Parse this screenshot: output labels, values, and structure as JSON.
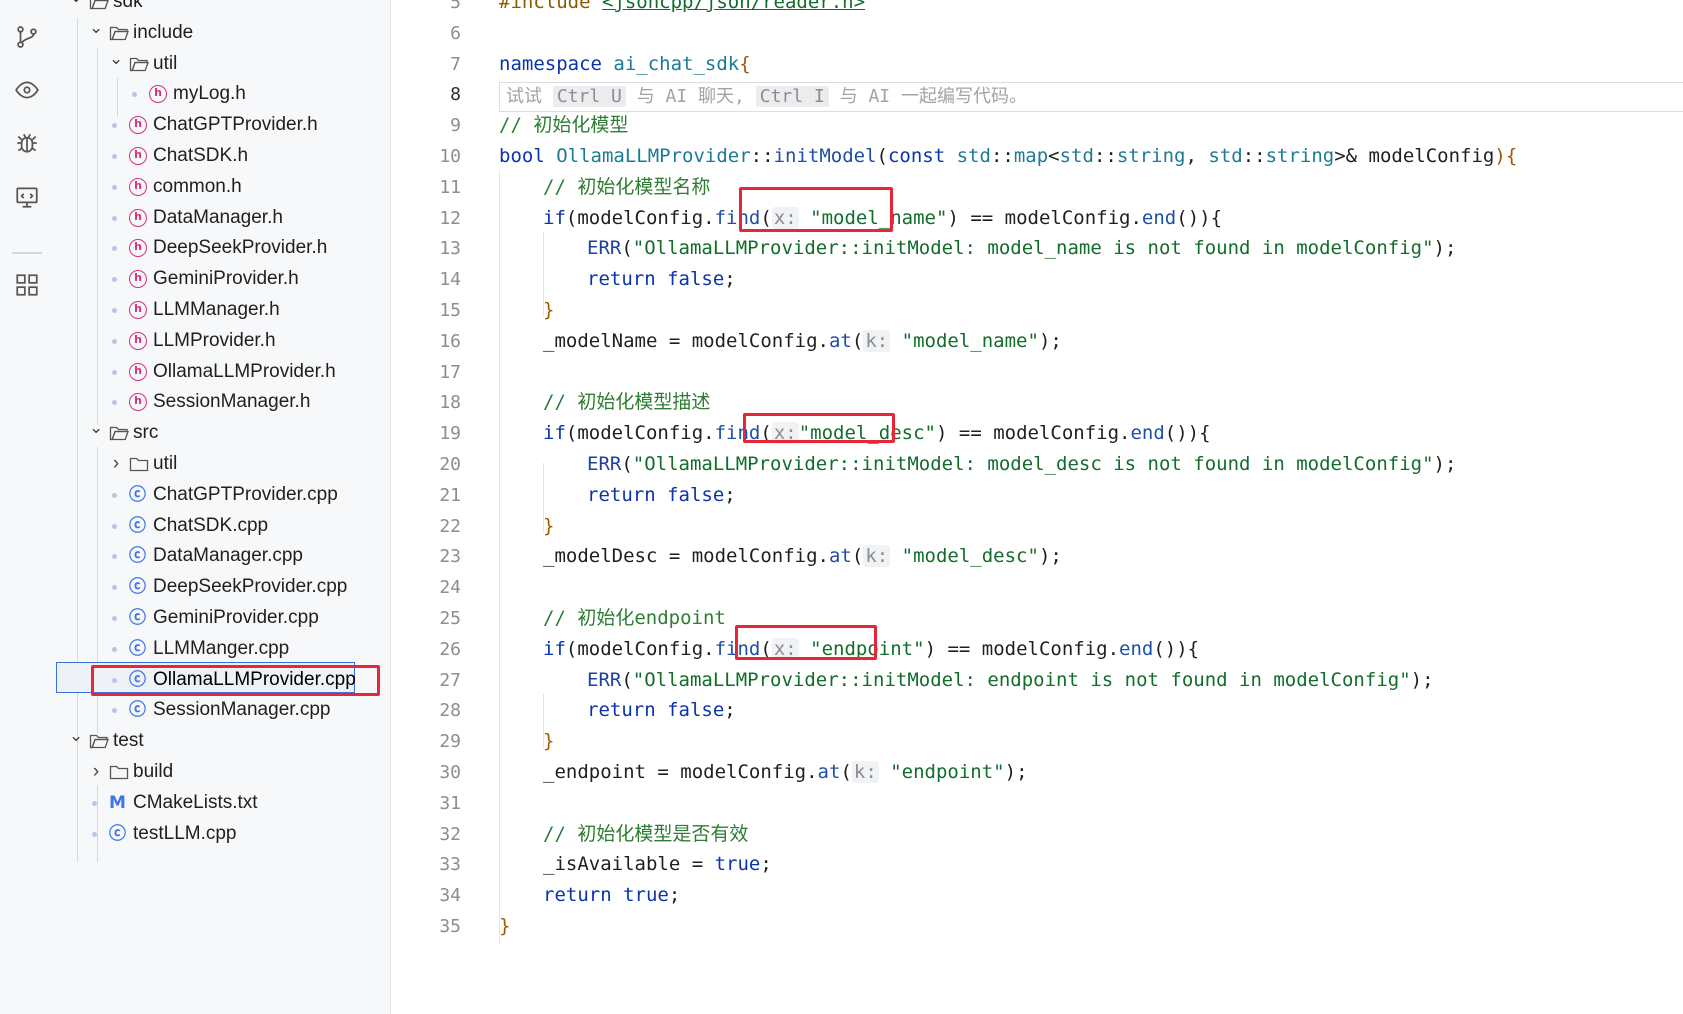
{
  "explorer": {
    "items": [
      {
        "label": "sdk",
        "kind": "folder",
        "expanded": true,
        "depth": 0
      },
      {
        "label": "include",
        "kind": "folder",
        "expanded": true,
        "depth": 1
      },
      {
        "label": "util",
        "kind": "folder",
        "expanded": true,
        "depth": 2
      },
      {
        "label": "myLog.h",
        "kind": "header",
        "depth": 3
      },
      {
        "label": "ChatGPTProvider.h",
        "kind": "header",
        "depth": 2
      },
      {
        "label": "ChatSDK.h",
        "kind": "header",
        "depth": 2
      },
      {
        "label": "common.h",
        "kind": "header",
        "depth": 2
      },
      {
        "label": "DataManager.h",
        "kind": "header",
        "depth": 2
      },
      {
        "label": "DeepSeekProvider.h",
        "kind": "header",
        "depth": 2
      },
      {
        "label": "GeminiProvider.h",
        "kind": "header",
        "depth": 2
      },
      {
        "label": "LLMManager.h",
        "kind": "header",
        "depth": 2
      },
      {
        "label": "LLMProvider.h",
        "kind": "header",
        "depth": 2
      },
      {
        "label": "OllamaLLMProvider.h",
        "kind": "header",
        "depth": 2
      },
      {
        "label": "SessionManager.h",
        "kind": "header",
        "depth": 2
      },
      {
        "label": "src",
        "kind": "folder",
        "expanded": true,
        "depth": 1
      },
      {
        "label": "util",
        "kind": "folder",
        "expanded": false,
        "depth": 2
      },
      {
        "label": "ChatGPTProvider.cpp",
        "kind": "cpp",
        "depth": 2
      },
      {
        "label": "ChatSDK.cpp",
        "kind": "cpp",
        "depth": 2
      },
      {
        "label": "DataManager.cpp",
        "kind": "cpp",
        "depth": 2
      },
      {
        "label": "DeepSeekProvider.cpp",
        "kind": "cpp",
        "depth": 2
      },
      {
        "label": "GeminiProvider.cpp",
        "kind": "cpp",
        "depth": 2
      },
      {
        "label": "LLMManger.cpp",
        "kind": "cpp",
        "depth": 2
      },
      {
        "label": "OllamaLLMProvider.cpp",
        "kind": "cpp",
        "depth": 2,
        "selected": true
      },
      {
        "label": "SessionManager.cpp",
        "kind": "cpp",
        "depth": 2
      },
      {
        "label": "test",
        "kind": "folder",
        "expanded": true,
        "depth": 0
      },
      {
        "label": "build",
        "kind": "folder",
        "expanded": false,
        "depth": 1
      },
      {
        "label": "CMakeLists.txt",
        "kind": "cmake",
        "depth": 1
      },
      {
        "label": "testLLM.cpp",
        "kind": "cpp",
        "depth": 1
      }
    ]
  },
  "editor": {
    "current_line": "8",
    "ai_hint": {
      "pre": "试试 ",
      "key1": "Ctrl U",
      "mid": " 与 AI 聊天, ",
      "key2": "Ctrl I",
      "post": " 与 AI 一起编写代码。"
    },
    "lines": [
      {
        "n": "5",
        "tokens": [
          [
            "inc",
            "#include "
          ],
          [
            "incp",
            "<jsoncpp/json/reader.h>"
          ]
        ]
      },
      {
        "n": "6",
        "tokens": []
      },
      {
        "n": "7",
        "tokens": [
          [
            "kw",
            "namespace "
          ],
          [
            "ns",
            "ai_chat_sdk"
          ],
          [
            "br",
            "{"
          ]
        ]
      },
      {
        "n": "8",
        "tokens": []
      },
      {
        "n": "9",
        "tokens": [
          [
            "cm",
            "// 初始化模型"
          ]
        ]
      },
      {
        "n": "10",
        "tokens": [
          [
            "kw",
            "bool "
          ],
          [
            "ty",
            "OllamaLLMProvider"
          ],
          [
            "pm",
            "::"
          ],
          [
            "fn",
            "initModel"
          ],
          [
            "pm",
            "("
          ],
          [
            "kw",
            "const "
          ],
          [
            "ty",
            "std"
          ],
          [
            "pm",
            "::"
          ],
          [
            "ty",
            "map"
          ],
          [
            "pm",
            "<"
          ],
          [
            "ty",
            "std"
          ],
          [
            "pm",
            "::"
          ],
          [
            "ty",
            "string"
          ],
          [
            "pm",
            ", "
          ],
          [
            "ty",
            "std"
          ],
          [
            "pm",
            "::"
          ],
          [
            "ty",
            "string"
          ],
          [
            "pm",
            ">& "
          ],
          [
            "pm",
            "modelConfig"
          ],
          [
            "br",
            ")"
          ],
          [
            "br",
            "{"
          ]
        ]
      },
      {
        "n": "11",
        "tokens": [
          [
            "cm",
            "// 初始化模型名称"
          ]
        ],
        "indent": 1
      },
      {
        "n": "12",
        "tokens": [
          [
            "kw",
            "if"
          ],
          [
            "pm",
            "(modelConfig."
          ],
          [
            "fn",
            "find"
          ],
          [
            "pm",
            "("
          ],
          [
            "hint",
            "x:"
          ],
          [
            "pm",
            " "
          ],
          [
            "str",
            "\"model_name\""
          ],
          [
            "pm",
            ") == modelConfig."
          ],
          [
            "fn",
            "end"
          ],
          [
            "pm",
            "()){"
          ]
        ],
        "indent": 1
      },
      {
        "n": "13",
        "tokens": [
          [
            "mac",
            "ERR"
          ],
          [
            "pm",
            "("
          ],
          [
            "str",
            "\"OllamaLLMProvider::initModel: model_name is not found in modelConfig\""
          ],
          [
            "pm",
            ");"
          ]
        ],
        "indent": 2
      },
      {
        "n": "14",
        "tokens": [
          [
            "kw",
            "return "
          ],
          [
            "kw",
            "false"
          ],
          [
            "pm",
            ";"
          ]
        ],
        "indent": 2
      },
      {
        "n": "15",
        "tokens": [
          [
            "br",
            "}"
          ]
        ],
        "indent": 1
      },
      {
        "n": "16",
        "tokens": [
          [
            "pm",
            "_modelName = modelConfig."
          ],
          [
            "fn",
            "at"
          ],
          [
            "pm",
            "("
          ],
          [
            "hint",
            "k:"
          ],
          [
            "pm",
            " "
          ],
          [
            "str",
            "\"model_name\""
          ],
          [
            "pm",
            ");"
          ]
        ],
        "indent": 1
      },
      {
        "n": "17",
        "tokens": []
      },
      {
        "n": "18",
        "tokens": [
          [
            "cm",
            "// 初始化模型描述"
          ]
        ],
        "indent": 1
      },
      {
        "n": "19",
        "tokens": [
          [
            "kw",
            "if"
          ],
          [
            "pm",
            "(modelConfig."
          ],
          [
            "fn",
            "find"
          ],
          [
            "pm",
            "("
          ],
          [
            "hint",
            "x:"
          ],
          [
            "str",
            "\"model_desc\""
          ],
          [
            "pm",
            ") == modelConfig."
          ],
          [
            "fn",
            "end"
          ],
          [
            "pm",
            "()){"
          ]
        ],
        "indent": 1
      },
      {
        "n": "20",
        "tokens": [
          [
            "mac",
            "ERR"
          ],
          [
            "pm",
            "("
          ],
          [
            "str",
            "\"OllamaLLMProvider::initModel: model_desc is not found in modelConfig\""
          ],
          [
            "pm",
            ");"
          ]
        ],
        "indent": 2
      },
      {
        "n": "21",
        "tokens": [
          [
            "kw",
            "return "
          ],
          [
            "kw",
            "false"
          ],
          [
            "pm",
            ";"
          ]
        ],
        "indent": 2
      },
      {
        "n": "22",
        "tokens": [
          [
            "br",
            "}"
          ]
        ],
        "indent": 1
      },
      {
        "n": "23",
        "tokens": [
          [
            "pm",
            "_modelDesc = modelConfig."
          ],
          [
            "fn",
            "at"
          ],
          [
            "pm",
            "("
          ],
          [
            "hint",
            "k:"
          ],
          [
            "pm",
            " "
          ],
          [
            "str",
            "\"model_desc\""
          ],
          [
            "pm",
            ");"
          ]
        ],
        "indent": 1
      },
      {
        "n": "24",
        "tokens": []
      },
      {
        "n": "25",
        "tokens": [
          [
            "cm",
            "// 初始化endpoint"
          ]
        ],
        "indent": 1
      },
      {
        "n": "26",
        "tokens": [
          [
            "kw",
            "if"
          ],
          [
            "pm",
            "(modelConfig."
          ],
          [
            "fn",
            "find"
          ],
          [
            "pm",
            "("
          ],
          [
            "hint",
            "x:"
          ],
          [
            "pm",
            " "
          ],
          [
            "str",
            "\"endpoint\""
          ],
          [
            "pm",
            ") == modelConfig."
          ],
          [
            "fn",
            "end"
          ],
          [
            "pm",
            "()){"
          ]
        ],
        "indent": 1
      },
      {
        "n": "27",
        "tokens": [
          [
            "mac",
            "ERR"
          ],
          [
            "pm",
            "("
          ],
          [
            "str",
            "\"OllamaLLMProvider::initModel: endpoint is not found in modelConfig\""
          ],
          [
            "pm",
            ");"
          ]
        ],
        "indent": 2
      },
      {
        "n": "28",
        "tokens": [
          [
            "kw",
            "return "
          ],
          [
            "kw",
            "false"
          ],
          [
            "pm",
            ";"
          ]
        ],
        "indent": 2
      },
      {
        "n": "29",
        "tokens": [
          [
            "br",
            "}"
          ]
        ],
        "indent": 1
      },
      {
        "n": "30",
        "tokens": [
          [
            "pm",
            "_endpoint = modelConfig."
          ],
          [
            "fn",
            "at"
          ],
          [
            "pm",
            "("
          ],
          [
            "hint",
            "k:"
          ],
          [
            "pm",
            " "
          ],
          [
            "str",
            "\"endpoint\""
          ],
          [
            "pm",
            ");"
          ]
        ],
        "indent": 1
      },
      {
        "n": "31",
        "tokens": []
      },
      {
        "n": "32",
        "tokens": [
          [
            "cm",
            "// 初始化模型是否有效"
          ]
        ],
        "indent": 1
      },
      {
        "n": "33",
        "tokens": [
          [
            "pm",
            "_isAvailable = "
          ],
          [
            "kw",
            "true"
          ],
          [
            "pm",
            ";"
          ]
        ],
        "indent": 1
      },
      {
        "n": "34",
        "tokens": [
          [
            "kw",
            "return "
          ],
          [
            "kw",
            "true"
          ],
          [
            "pm",
            ";"
          ]
        ],
        "indent": 1
      },
      {
        "n": "35",
        "tokens": [
          [
            "br",
            "}"
          ]
        ]
      }
    ]
  },
  "colors": {
    "highlight_box": "#e8263a",
    "selection_border": "#3d6fd8",
    "keyword": "#0b33ab",
    "string": "#126d2b",
    "comment": "#2e7d32"
  },
  "icons": [
    "source-control-icon",
    "eye-icon",
    "debug-icon",
    "remote-explorer-icon",
    "extensions-icon",
    "folder-icon",
    "header-file-icon",
    "cpp-file-icon",
    "cmake-file-icon",
    "chevron-down-icon",
    "chevron-right-icon"
  ]
}
